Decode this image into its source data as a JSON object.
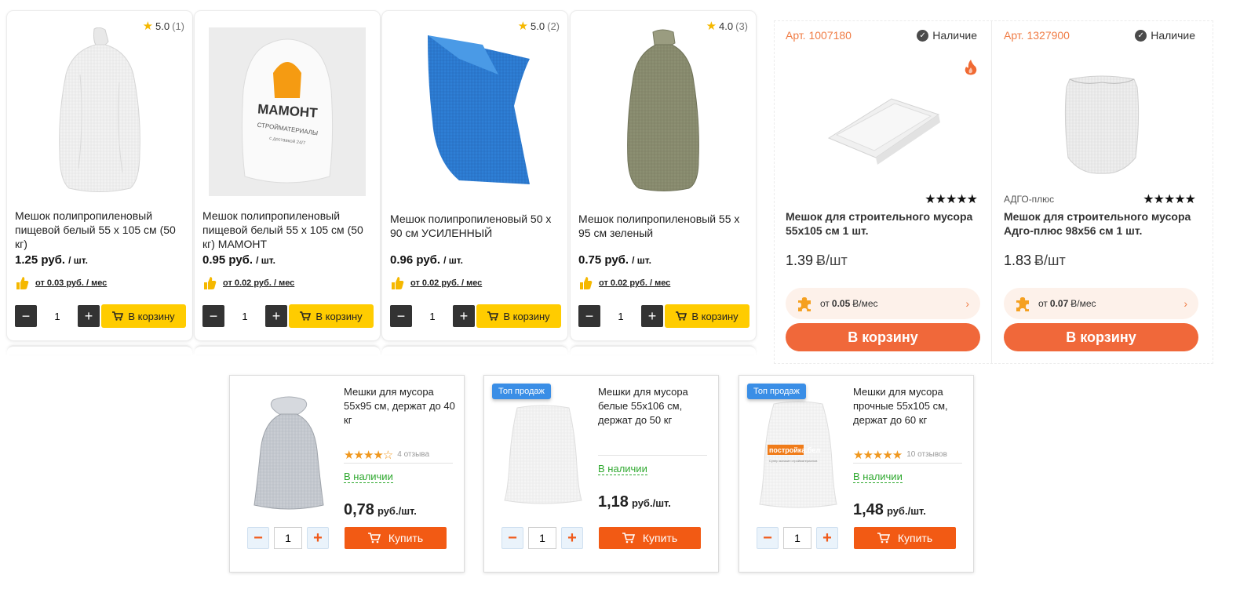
{
  "group_a": [
    {
      "rating": "5.0",
      "reviews": "(1)",
      "title": "Мешок полипропиленовый пищевой белый 55 x 105 см (50 кг)",
      "price": "1.25 руб.",
      "unit": "/ шт.",
      "installment": "от 0.03 руб. / мес",
      "qty": "1",
      "cart": "В корзину"
    },
    {
      "rating": "",
      "reviews": "",
      "title": "Мешок полипропиленовый пищевой белый 55 x 105 см (50 кг) МАМОНТ",
      "price": "0.95 руб.",
      "unit": "/ шт.",
      "installment": "от 0.02 руб. / мес",
      "qty": "1",
      "cart": "В корзину",
      "logo_text": "МАМОНТ",
      "logo_sub": "СТРОЙМАТЕРИАЛЫ",
      "logo_sub2": "с доставкой 24/7"
    },
    {
      "rating": "5.0",
      "reviews": "(2)",
      "title": "Мешок полипропиленовый 50 x 90 см УСИЛЕННЫЙ",
      "price": "0.96 руб.",
      "unit": "/ шт.",
      "installment": "от 0.02 руб. / мес",
      "qty": "1",
      "cart": "В корзину"
    },
    {
      "rating": "4.0",
      "reviews": "(3)",
      "title": "Мешок полипропиленовый 55 x 95 см зеленый",
      "price": "0.75 руб.",
      "unit": "/ шт.",
      "installment": "от 0.02 руб. / мес",
      "qty": "1",
      "cart": "В корзину"
    }
  ],
  "group_b": [
    {
      "art": "Арт. 1007180",
      "stock": "Наличие",
      "brand": "",
      "stars": "★★★★★",
      "title": "Мешок для строительного мусора 55x105 см 1 шт.",
      "price": "1.39",
      "unit": "Ƀ/шт",
      "installment_from": "от",
      "installment_value": "0.05",
      "installment_unit": "Ƀ/мес",
      "cart": "В корзину",
      "hot": true
    },
    {
      "art": "Арт. 1327900",
      "stock": "Наличие",
      "brand": "АДГО-плюс",
      "stars": "★★★★★",
      "title": "Мешок для строительного мусора Адго-плюс 98x56 см 1 шт.",
      "price": "1.83",
      "unit": "Ƀ/шт",
      "installment_from": "от",
      "installment_value": "0.07",
      "installment_unit": "Ƀ/мес",
      "cart": "В корзину",
      "hot": false
    }
  ],
  "group_c": [
    {
      "badge": "",
      "title": "Мешки для мусора 55x95 см, держат до 40 кг",
      "stars": "★★★★☆",
      "reviews": "4 отзыва",
      "stock": "В наличии",
      "price": "0,78",
      "unit": "руб./шт.",
      "qty": "1",
      "buy": "Купить"
    },
    {
      "badge": "Топ продаж",
      "title": "Мешки для мусора белые 55x106 см, держат до 50 кг",
      "stars": "",
      "reviews": "",
      "stock": "В наличии",
      "price": "1,18",
      "unit": "руб./шт.",
      "qty": "1",
      "buy": "Купить"
    },
    {
      "badge": "Топ продаж",
      "title": "Мешки для мусора прочные 55x105 см, держат до 60 кг",
      "stars": "★★★★★",
      "reviews": "10 отзывов",
      "stock": "В наличии",
      "price": "1,48",
      "unit": "руб./шт.",
      "qty": "1",
      "buy": "Купить",
      "logo_text": "постройка.бел",
      "logo_sub": "Супер магазин стройматериалов"
    }
  ],
  "colors": {
    "yellow": "#ffcc00",
    "orange": "#f0683a",
    "blue_badge": "#3a8ee6",
    "buy_orange": "#f25a14",
    "stock_green": "#2ea82e"
  }
}
